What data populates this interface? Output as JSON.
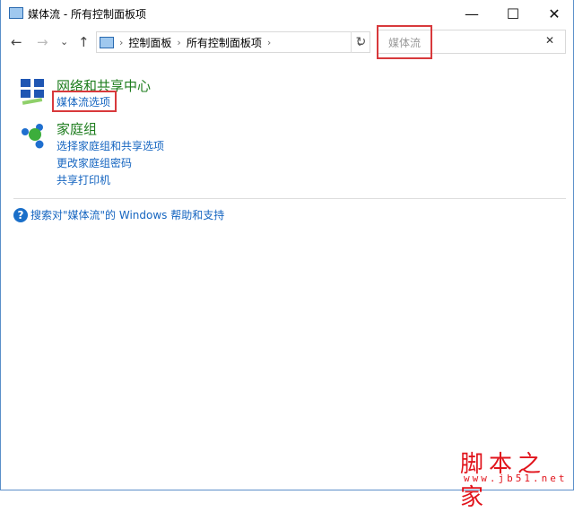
{
  "window": {
    "title": "媒体流 - 所有控制面板项",
    "minimize": "—",
    "maximize": "☐",
    "close": "✕"
  },
  "nav": {
    "back": "←",
    "forward": "→",
    "recent": "⌄",
    "up": "↑",
    "refresh": "↻",
    "dropdown": "⌄"
  },
  "breadcrumb": [
    "控制面板",
    "所有控制面板项"
  ],
  "breadcrumb_sep": "›",
  "search": {
    "value": "媒体流",
    "clear": "✕"
  },
  "results": [
    {
      "title": "网络和共享中心",
      "links": [
        "媒体流选项"
      ]
    },
    {
      "title": "家庭组",
      "links": [
        "选择家庭组和共享选项",
        "更改家庭组密码",
        "共享打印机"
      ]
    }
  ],
  "help": {
    "icon": "?",
    "text": "搜索对\"媒体流\"的 Windows 帮助和支持"
  },
  "watermark": {
    "text": "脚本之家",
    "url": "www.jb51.net"
  },
  "colors": {
    "highlight": "#d8393c",
    "group": "#1e7d1e",
    "link": "#1565c0"
  }
}
